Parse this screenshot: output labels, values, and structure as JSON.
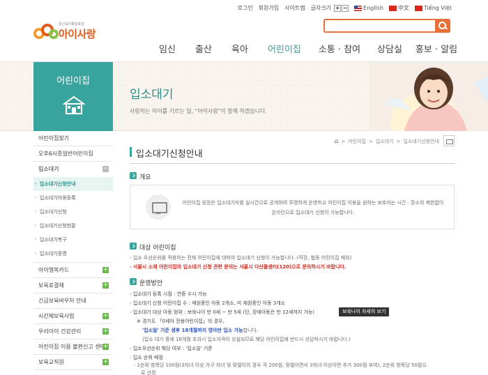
{
  "util": {
    "login": "로그인",
    "join": "회원가입",
    "sitemap": "사이트맵",
    "font_size": "글자크기",
    "plus": "+",
    "minus": "−",
    "lang_en": "English",
    "lang_cn": "中文",
    "lang_vn": "Tiếng Việt"
  },
  "logo": {
    "sub": "임신육아종합포털",
    "name": "아이사랑"
  },
  "gnb": [
    {
      "label": "임신",
      "w": 52
    },
    {
      "label": "출산",
      "w": 52
    },
    {
      "label": "육아",
      "w": 52
    },
    {
      "label": "어린이집",
      "w": 76
    },
    {
      "label": "소통 · 참여",
      "w": 82
    },
    {
      "label": "상담실",
      "w": 62
    },
    {
      "label": "홍보 · 알림",
      "w": 72
    }
  ],
  "section": {
    "title": "어린이집"
  },
  "page": {
    "title": "입소대기",
    "subtitle": "사랑하는 아이를 기르는 일, \"아이사랑\"이 함께 하겠습니다."
  },
  "sidebar": {
    "items_top": [
      "어린이집찾기",
      "오후6시종일반어린이집"
    ],
    "open": "입소대기",
    "subs": [
      "입소대기신청안내",
      "입소대기아동등록",
      "입소대기신청",
      "입소대기신청현황",
      "입소대기복구",
      "입소대기증명"
    ],
    "items_bottom": [
      {
        "label": "아이행복카드",
        "pm": "+"
      },
      {
        "label": "보육료결제",
        "pm": "+"
      },
      {
        "label": "긴급보육바우처 안내",
        "pm": ""
      },
      {
        "label": "시간제보육사업",
        "pm": "+"
      },
      {
        "label": "우리아이 건강관리",
        "pm": "+"
      },
      {
        "label": "어린이집 이용 불편신고 센터",
        "pm": "+"
      },
      {
        "label": "보육교직원",
        "pm": "+"
      }
    ]
  },
  "breadcrumb": {
    "home": "⌂",
    "l1": "어린이집",
    "l2": "입소대기",
    "l3": "입소대기신청안내",
    "sep": ">"
  },
  "content": {
    "heading": "입소대기신청안내",
    "overview_title": "개요",
    "overview_text": "어린이집 원장은 입소대기자를 실시간으로 공개하여 투명하게 운영하고 어린이집 이용을 원하는 보호자는 시간 · 장소의 제한없이 온라인으로 입소대기 신청이 가능합니다.",
    "target_title": "대상 어린이집",
    "target_1": "입소 우선순위를 적용하는 전체 어린이집에 대하여 입소대기 신청이 가능합니다. (직장, 협동 어린이집 제외)",
    "target_2": "서울시 소재 어린이집의 입소대기 신청 관련 문의는 서울시 다산콜센터(120)으로 문의하시기 바랍니다.",
    "ops_title": "운영방안",
    "ops_1": "입소대기 등록 시점 : 연중 수시 가능",
    "ops_2": "입소대기 신청 어린이집 수 : 재원중인 아동 2개소, 미 재원중인 아동 3개소",
    "ops_3": "입소대기 대상 아동 범위 : 보육나이 만 0세 ~ 만 5세 (단, 장애아동은 만 12세까지 가능)",
    "ops_3a_pre": "※ 경기도 「0세아 전용어린이집」의 경우,",
    "ops_3b_blue": "'입소일' 기준 생후 18개월까지 영아만 입소 가능",
    "ops_3b_post": "합니다.",
    "ops_3c": "(입소 대기 중에 18개월 초과시 입소자격이 상실되므로 해당 어린이집에 반드시 상담하시기 바랍니다.)",
    "ops_4": "입소우선순위 해당 여부 : '입소일' 기준",
    "ops_5": "입소 순위 배점",
    "ops_6": "· 1순위 항목당 100점(3자녀 이상 가구 자녀 및 맞벌이의 경우 각 200점, 맞벌이면서 3자녀 이상이면 추가 300점 부여), 2순위 항목당 50점으",
    "ops_7": "로 산정"
  },
  "tooltip": "보육나이 자세히 보기",
  "colors": {
    "accent": "#39a39d",
    "orange": "#e8703a",
    "red": "#d2261b",
    "blue": "#2a52c0"
  }
}
